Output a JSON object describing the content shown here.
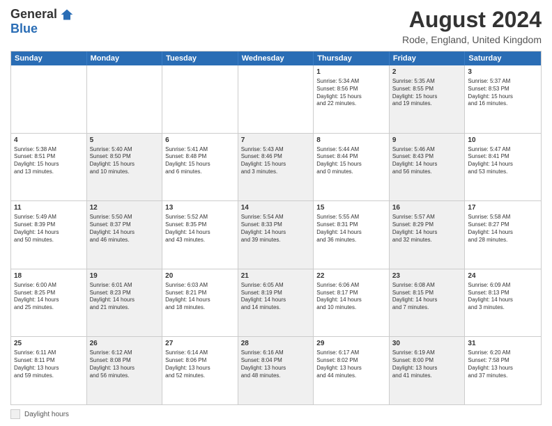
{
  "header": {
    "logo_general": "General",
    "logo_blue": "Blue",
    "month_year": "August 2024",
    "location": "Rode, England, United Kingdom"
  },
  "day_headers": [
    "Sunday",
    "Monday",
    "Tuesday",
    "Wednesday",
    "Thursday",
    "Friday",
    "Saturday"
  ],
  "footer": {
    "legend_label": "Daylight hours"
  },
  "weeks": [
    [
      {
        "day": "",
        "info": "",
        "shaded": false
      },
      {
        "day": "",
        "info": "",
        "shaded": false
      },
      {
        "day": "",
        "info": "",
        "shaded": false
      },
      {
        "day": "",
        "info": "",
        "shaded": false
      },
      {
        "day": "1",
        "info": "Sunrise: 5:34 AM\nSunset: 8:56 PM\nDaylight: 15 hours\nand 22 minutes.",
        "shaded": false
      },
      {
        "day": "2",
        "info": "Sunrise: 5:35 AM\nSunset: 8:55 PM\nDaylight: 15 hours\nand 19 minutes.",
        "shaded": true
      },
      {
        "day": "3",
        "info": "Sunrise: 5:37 AM\nSunset: 8:53 PM\nDaylight: 15 hours\nand 16 minutes.",
        "shaded": false
      }
    ],
    [
      {
        "day": "4",
        "info": "Sunrise: 5:38 AM\nSunset: 8:51 PM\nDaylight: 15 hours\nand 13 minutes.",
        "shaded": false
      },
      {
        "day": "5",
        "info": "Sunrise: 5:40 AM\nSunset: 8:50 PM\nDaylight: 15 hours\nand 10 minutes.",
        "shaded": true
      },
      {
        "day": "6",
        "info": "Sunrise: 5:41 AM\nSunset: 8:48 PM\nDaylight: 15 hours\nand 6 minutes.",
        "shaded": false
      },
      {
        "day": "7",
        "info": "Sunrise: 5:43 AM\nSunset: 8:46 PM\nDaylight: 15 hours\nand 3 minutes.",
        "shaded": true
      },
      {
        "day": "8",
        "info": "Sunrise: 5:44 AM\nSunset: 8:44 PM\nDaylight: 15 hours\nand 0 minutes.",
        "shaded": false
      },
      {
        "day": "9",
        "info": "Sunrise: 5:46 AM\nSunset: 8:43 PM\nDaylight: 14 hours\nand 56 minutes.",
        "shaded": true
      },
      {
        "day": "10",
        "info": "Sunrise: 5:47 AM\nSunset: 8:41 PM\nDaylight: 14 hours\nand 53 minutes.",
        "shaded": false
      }
    ],
    [
      {
        "day": "11",
        "info": "Sunrise: 5:49 AM\nSunset: 8:39 PM\nDaylight: 14 hours\nand 50 minutes.",
        "shaded": false
      },
      {
        "day": "12",
        "info": "Sunrise: 5:50 AM\nSunset: 8:37 PM\nDaylight: 14 hours\nand 46 minutes.",
        "shaded": true
      },
      {
        "day": "13",
        "info": "Sunrise: 5:52 AM\nSunset: 8:35 PM\nDaylight: 14 hours\nand 43 minutes.",
        "shaded": false
      },
      {
        "day": "14",
        "info": "Sunrise: 5:54 AM\nSunset: 8:33 PM\nDaylight: 14 hours\nand 39 minutes.",
        "shaded": true
      },
      {
        "day": "15",
        "info": "Sunrise: 5:55 AM\nSunset: 8:31 PM\nDaylight: 14 hours\nand 36 minutes.",
        "shaded": false
      },
      {
        "day": "16",
        "info": "Sunrise: 5:57 AM\nSunset: 8:29 PM\nDaylight: 14 hours\nand 32 minutes.",
        "shaded": true
      },
      {
        "day": "17",
        "info": "Sunrise: 5:58 AM\nSunset: 8:27 PM\nDaylight: 14 hours\nand 28 minutes.",
        "shaded": false
      }
    ],
    [
      {
        "day": "18",
        "info": "Sunrise: 6:00 AM\nSunset: 8:25 PM\nDaylight: 14 hours\nand 25 minutes.",
        "shaded": false
      },
      {
        "day": "19",
        "info": "Sunrise: 6:01 AM\nSunset: 8:23 PM\nDaylight: 14 hours\nand 21 minutes.",
        "shaded": true
      },
      {
        "day": "20",
        "info": "Sunrise: 6:03 AM\nSunset: 8:21 PM\nDaylight: 14 hours\nand 18 minutes.",
        "shaded": false
      },
      {
        "day": "21",
        "info": "Sunrise: 6:05 AM\nSunset: 8:19 PM\nDaylight: 14 hours\nand 14 minutes.",
        "shaded": true
      },
      {
        "day": "22",
        "info": "Sunrise: 6:06 AM\nSunset: 8:17 PM\nDaylight: 14 hours\nand 10 minutes.",
        "shaded": false
      },
      {
        "day": "23",
        "info": "Sunrise: 6:08 AM\nSunset: 8:15 PM\nDaylight: 14 hours\nand 7 minutes.",
        "shaded": true
      },
      {
        "day": "24",
        "info": "Sunrise: 6:09 AM\nSunset: 8:13 PM\nDaylight: 14 hours\nand 3 minutes.",
        "shaded": false
      }
    ],
    [
      {
        "day": "25",
        "info": "Sunrise: 6:11 AM\nSunset: 8:11 PM\nDaylight: 13 hours\nand 59 minutes.",
        "shaded": false
      },
      {
        "day": "26",
        "info": "Sunrise: 6:12 AM\nSunset: 8:08 PM\nDaylight: 13 hours\nand 56 minutes.",
        "shaded": true
      },
      {
        "day": "27",
        "info": "Sunrise: 6:14 AM\nSunset: 8:06 PM\nDaylight: 13 hours\nand 52 minutes.",
        "shaded": false
      },
      {
        "day": "28",
        "info": "Sunrise: 6:16 AM\nSunset: 8:04 PM\nDaylight: 13 hours\nand 48 minutes.",
        "shaded": true
      },
      {
        "day": "29",
        "info": "Sunrise: 6:17 AM\nSunset: 8:02 PM\nDaylight: 13 hours\nand 44 minutes.",
        "shaded": false
      },
      {
        "day": "30",
        "info": "Sunrise: 6:19 AM\nSunset: 8:00 PM\nDaylight: 13 hours\nand 41 minutes.",
        "shaded": true
      },
      {
        "day": "31",
        "info": "Sunrise: 6:20 AM\nSunset: 7:58 PM\nDaylight: 13 hours\nand 37 minutes.",
        "shaded": false
      }
    ]
  ]
}
